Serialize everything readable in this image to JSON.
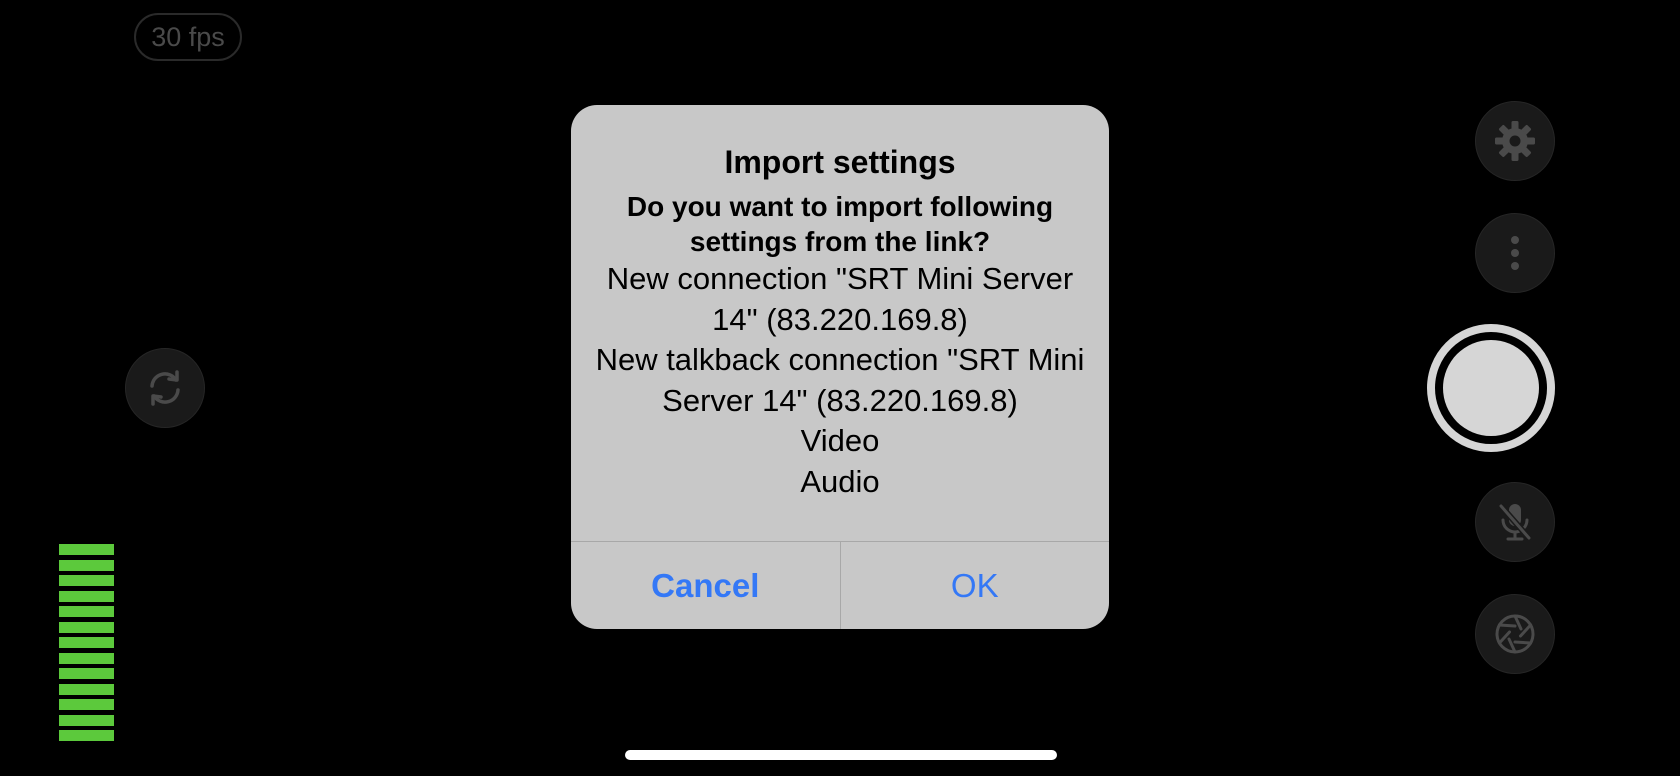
{
  "status": {
    "fps_label": "30 fps"
  },
  "dialog": {
    "title": "Import settings",
    "question": "Do you want to import following settings from the link?",
    "items": [
      "New connection \"SRT Mini Server 14\" (83.220.169.8)",
      "New talkback connection \"SRT Mini Server 14\" (83.220.169.8)",
      "Video",
      "Audio"
    ],
    "cancel_label": "Cancel",
    "ok_label": "OK"
  },
  "controls": {
    "left": [
      "flip-camera-icon"
    ],
    "right": [
      "gear-icon",
      "more-vertical-icon",
      "record-button",
      "mic-off-icon",
      "aperture-icon"
    ]
  },
  "audio_meter": {
    "active_bars": 13,
    "color": "#5cc93c"
  },
  "colors": {
    "background": "#000000",
    "dialog_background": "#c8c8c8",
    "accent": "#3478f6",
    "control_icon": "#4a4a4a",
    "record_ring": "#d6d6d6"
  }
}
